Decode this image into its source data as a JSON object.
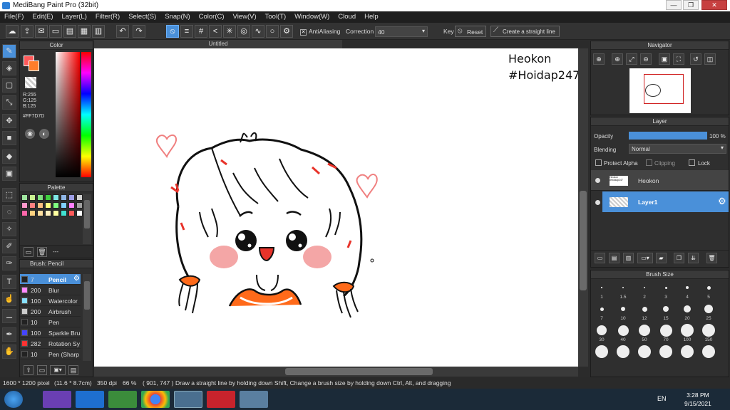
{
  "window": {
    "title": "MediBang Paint Pro (32bit)",
    "minimize": "—",
    "restore": "❐",
    "close": "✕"
  },
  "menu": [
    "File(F)",
    "Edit(E)",
    "Layer(L)",
    "Filter(R)",
    "Select(S)",
    "Snap(N)",
    "Color(C)",
    "View(V)",
    "Tool(T)",
    "Window(W)",
    "Cloud",
    "Help"
  ],
  "toolbar": {
    "antialiasing_label": "AntiAliasing",
    "correction_label": "Correction",
    "correction_value": "40",
    "key_label": "Key",
    "reset_label": "Reset",
    "straight_line_label": "Create a straight line"
  },
  "color_panel": {
    "title": "Color",
    "r": "R:255",
    "g": "G:125",
    "b": "B:125",
    "hex": "#FF7D7D",
    "primary_color": "#ff5a5a",
    "secondary_color": "#ff7d2a"
  },
  "palette_panel": {
    "title": "Palette",
    "colors": [
      "#9fe59f",
      "#c8f08f",
      "#7fe07f",
      "#3fd03f",
      "#7fe7e7",
      "#8fb7e7",
      "#9f9fe7",
      "#d0d0d0",
      "#ff99cc",
      "#ff8080",
      "#ffbf80",
      "#ffff80",
      "#80ff80",
      "#80d0ff",
      "#ff80ff",
      "#a0a0a0",
      "#ff66aa",
      "#ffd280",
      "#ffe0a0",
      "#fff0c0",
      "#ffffa0",
      "#40e0d0",
      "#ff5a5a",
      "#ffffff"
    ],
    "footer_text": "---"
  },
  "brush_panel": {
    "title": "Brush: Pencil",
    "brushes": [
      {
        "size": "7",
        "name": "Pencil",
        "color": "#222222",
        "active": true
      },
      {
        "size": "200",
        "name": "Blur",
        "color": "#ff88ff"
      },
      {
        "size": "100",
        "name": "Watercolor",
        "color": "#88e0ff"
      },
      {
        "size": "200",
        "name": "Airbrush",
        "color": "#cccccc"
      },
      {
        "size": "10",
        "name": "Pen",
        "color": "#222222"
      },
      {
        "size": "100",
        "name": "Sparkle Bru",
        "color": "#4444ff"
      },
      {
        "size": "282",
        "name": "Rotation Sy",
        "color": "#ff3333"
      },
      {
        "size": "10",
        "name": "Pen (Sharp",
        "color": "#222222"
      }
    ]
  },
  "canvas": {
    "tab_title": "Untitled",
    "text_line1": "Heokon",
    "text_line2": "#Hoidap247"
  },
  "navigator": {
    "title": "Navigator"
  },
  "layer_panel": {
    "title": "Layer",
    "opacity_label": "Opacity",
    "opacity_value": "100 %",
    "opacity_fraction": 1.0,
    "blending_label": "Blending",
    "blending_value": "Normal",
    "protect_alpha": "Protect Alpha",
    "clipping": "Clipping",
    "lock": "Lock",
    "layers": [
      {
        "name": "Heokon",
        "thumb_text": "Heokon #Hoidap247"
      },
      {
        "name": "Layer1",
        "active": true
      }
    ]
  },
  "brush_size_panel": {
    "title": "Brush Size",
    "sizes": [
      "1",
      "1.5",
      "2",
      "3",
      "4",
      "5",
      "7",
      "10",
      "12",
      "15",
      "20",
      "25",
      "30",
      "40",
      "50",
      "70",
      "100",
      "150",
      "",
      "",
      "",
      "",
      "",
      ""
    ]
  },
  "status": {
    "dimensions": "1600 * 1200 pixel",
    "physical": "(11.6 * 8.7cm)",
    "dpi": "350 dpi",
    "zoom": "66 %",
    "coords": "( 901, 747 )",
    "hint": "Draw a straight line by holding down Shift, Change a brush size by holding down Ctrl, Alt, and dragging"
  },
  "taskbar": {
    "lang": "EN",
    "time": "3:28 PM",
    "date": "9/15/2021"
  }
}
